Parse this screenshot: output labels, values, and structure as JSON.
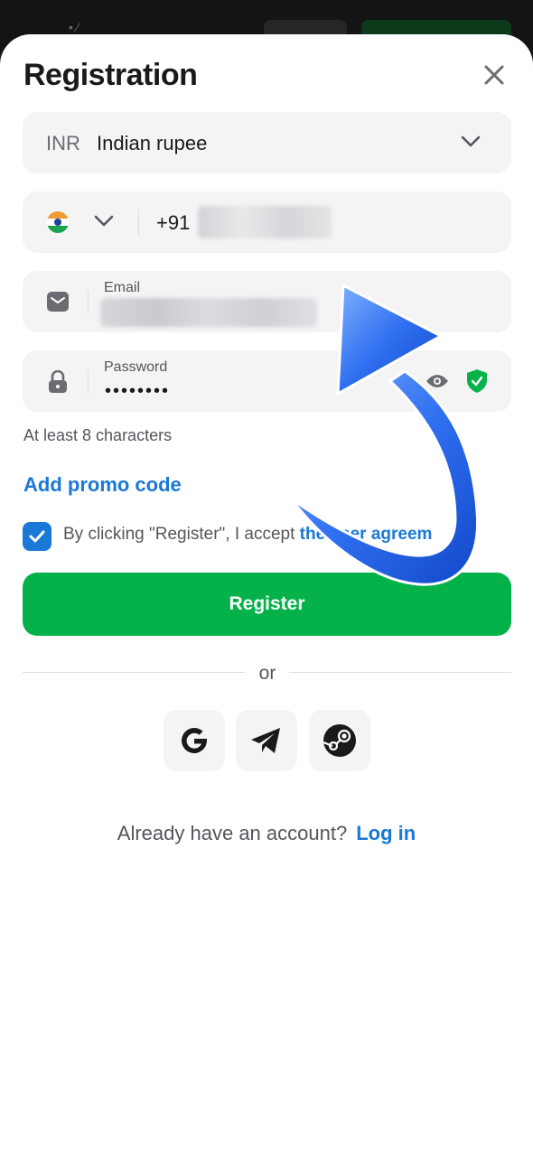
{
  "title": "Registration",
  "currency": {
    "code": "INR",
    "name": "Indian rupee"
  },
  "phone": {
    "prefix": "+91"
  },
  "email": {
    "label": "Email"
  },
  "password": {
    "label": "Password",
    "value": "••••••••"
  },
  "hint": "At least 8 characters",
  "promo": "Add promo code",
  "agreement": {
    "text": "By clicking \"Register\", I accept ",
    "link": "the user agreem"
  },
  "register_label": "Register",
  "or_label": "or",
  "login": {
    "question": "Already have an account?",
    "link": "Log in"
  },
  "colors": {
    "accent": "#1a78d6",
    "register": "#04b249",
    "field_bg": "#f4f4f5",
    "shield": "#04b249"
  },
  "icons": [
    "close-icon",
    "chevron-down-icon",
    "india-flag-icon",
    "mail-icon",
    "lock-icon",
    "eye-icon",
    "shield-check-icon",
    "checkbox-check-icon",
    "google-icon",
    "telegram-icon",
    "steam-icon",
    "arrow-annotation"
  ]
}
